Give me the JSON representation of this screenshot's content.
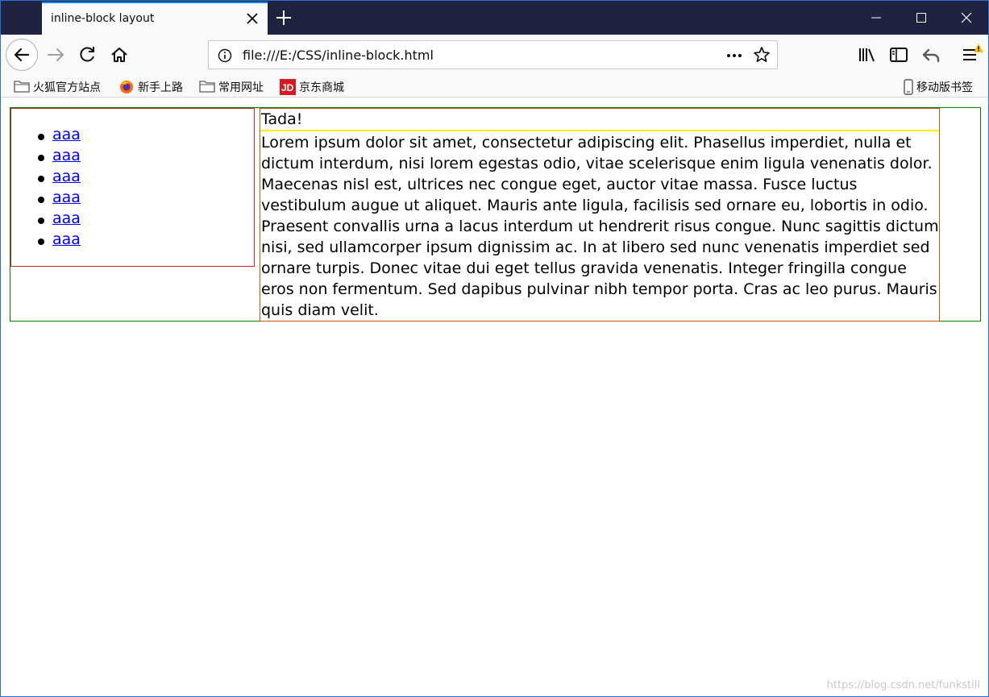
{
  "tab": {
    "title": "inline-block layout"
  },
  "url": {
    "text": "file:///E:/CSS/inline-block.html"
  },
  "bookmarks": [
    {
      "label": "火狐官方站点",
      "icon": "folder-icon"
    },
    {
      "label": "新手上路",
      "icon": "firefox-icon"
    },
    {
      "label": "常用网址",
      "icon": "folder-icon"
    },
    {
      "label": "京东商城",
      "icon": "jd-icon"
    }
  ],
  "mobile_bookmarks": {
    "label": "移动版书签"
  },
  "page": {
    "nav_links": [
      "aaa",
      "aaa",
      "aaa",
      "aaa",
      "aaa",
      "aaa"
    ],
    "heading": "Tada!",
    "paragraph": "Lorem ipsum dolor sit amet, consectetur adipiscing elit. Phasellus imperdiet, nulla et dictum interdum, nisi lorem egestas odio, vitae scelerisque enim ligula venenatis dolor. Maecenas nisl est, ultrices nec congue eget, auctor vitae massa. Fusce luctus vestibulum augue ut aliquet. Mauris ante ligula, facilisis sed ornare eu, lobortis in odio. Praesent convallis urna a lacus interdum ut hendrerit risus congue. Nunc sagittis dictum nisi, sed ullamcorper ipsum dignissim ac. In at libero sed nunc venenatis imperdiet sed ornare turpis. Donec vitae dui eget tellus gravida venenatis. Integer fringilla congue eros non fermentum. Sed dapibus pulvinar nibh tempor porta. Cras ac leo purus. Mauris quis diam velit."
  },
  "watermark": "https://blog.csdn.net/funkstill",
  "colors": {
    "tabbar": "#202340",
    "accent": "#0a84ff",
    "nav_border": "#cc2222",
    "outer_border": "#008000",
    "article_border": "#cc5500",
    "heading_border": "#ffee00",
    "link": "#0000ee"
  }
}
